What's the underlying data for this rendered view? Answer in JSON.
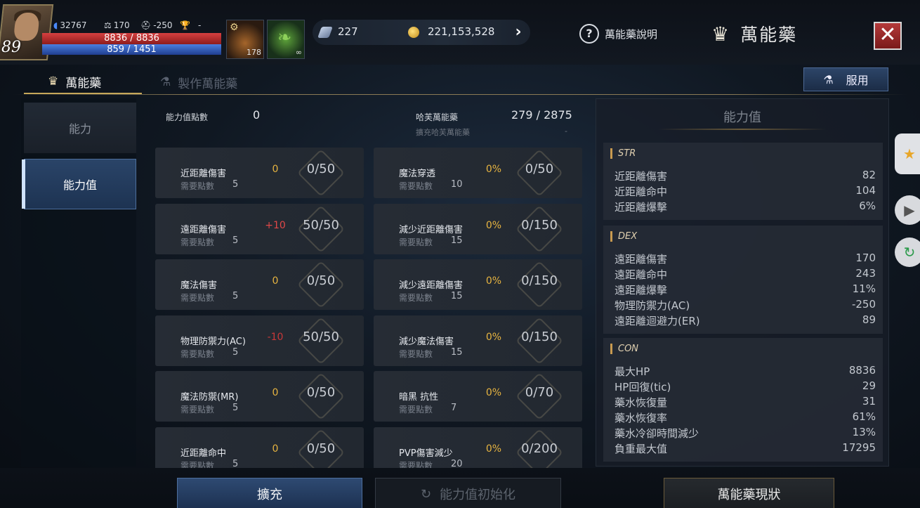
{
  "hud": {
    "level": "89",
    "power": "32767",
    "weight": "170",
    "alignment": "-250",
    "trophy": "-",
    "hp": "8836 / 8836",
    "mp": "859 / 1451",
    "slot1_count": "178",
    "slot2_count": "∞",
    "gems": "227",
    "gold": "221,153,528",
    "help_label": "萬能藥說明",
    "title": "萬能藥"
  },
  "tabs": {
    "potion": "萬能藥",
    "craft": "製作萬能藥",
    "use_button": "服用"
  },
  "nav": {
    "ability": "能力",
    "stats": "能力值"
  },
  "center": {
    "points_label": "能力值點數",
    "points_value": "0",
    "hagen_label": "哈芙萬能藥",
    "hagen_value": "279 / 2875",
    "hagen_hint": "擴充哈芙萬能藥",
    "hagen_hint_value": "-",
    "need_label": "需要點數",
    "left_stats": [
      {
        "name": "近距離傷害",
        "cost": "5",
        "bonus": "0",
        "level": "0/50"
      },
      {
        "name": "遠距離傷害",
        "cost": "5",
        "bonus": "+10",
        "level": "50/50"
      },
      {
        "name": "魔法傷害",
        "cost": "5",
        "bonus": "0",
        "level": "0/50"
      },
      {
        "name": "物理防禦力(AC)",
        "cost": "5",
        "bonus": "-10",
        "level": "50/50"
      },
      {
        "name": "魔法防禦(MR)",
        "cost": "5",
        "bonus": "0",
        "level": "0/50"
      },
      {
        "name": "近距離命中",
        "cost": "5",
        "bonus": "0",
        "level": "0/50"
      }
    ],
    "right_stats": [
      {
        "name": "魔法穿透",
        "cost": "10",
        "bonus": "0%",
        "level": "0/50"
      },
      {
        "name": "減少近距離傷害",
        "cost": "15",
        "bonus": "0%",
        "level": "0/150"
      },
      {
        "name": "減少遠距離傷害",
        "cost": "15",
        "bonus": "0%",
        "level": "0/150"
      },
      {
        "name": "減少魔法傷害",
        "cost": "15",
        "bonus": "0%",
        "level": "0/150"
      },
      {
        "name": "暗黑 抗性",
        "cost": "7",
        "bonus": "0%",
        "level": "0/70"
      },
      {
        "name": "PVP傷害減少",
        "cost": "20",
        "bonus": "0%",
        "level": "0/200"
      }
    ]
  },
  "panel": {
    "title": "能力值",
    "groups": [
      {
        "name": "STR",
        "rows": [
          {
            "n": "近距離傷害",
            "v": "82"
          },
          {
            "n": "近距離命中",
            "v": "104"
          },
          {
            "n": "近距離爆擊",
            "v": "6%"
          }
        ]
      },
      {
        "name": "DEX",
        "rows": [
          {
            "n": "遠距離傷害",
            "v": "170"
          },
          {
            "n": "遠距離命中",
            "v": "243"
          },
          {
            "n": "遠距離爆擊",
            "v": "11%"
          },
          {
            "n": "物理防禦力(AC)",
            "v": "-250"
          },
          {
            "n": "遠距離迴避力(ER)",
            "v": "89"
          }
        ]
      },
      {
        "name": "CON",
        "rows": [
          {
            "n": "最大HP",
            "v": "8836"
          },
          {
            "n": "HP回復(tic)",
            "v": "29"
          },
          {
            "n": "藥水恢復量",
            "v": "31"
          },
          {
            "n": "藥水恢復率",
            "v": "61%"
          },
          {
            "n": "藥水冷卻時間減少",
            "v": "13%"
          },
          {
            "n": "負重最大值",
            "v": "17295"
          }
        ]
      }
    ]
  },
  "bottom": {
    "expand": "擴充",
    "reset": "能力值初始化",
    "status": "萬能藥現狀"
  }
}
